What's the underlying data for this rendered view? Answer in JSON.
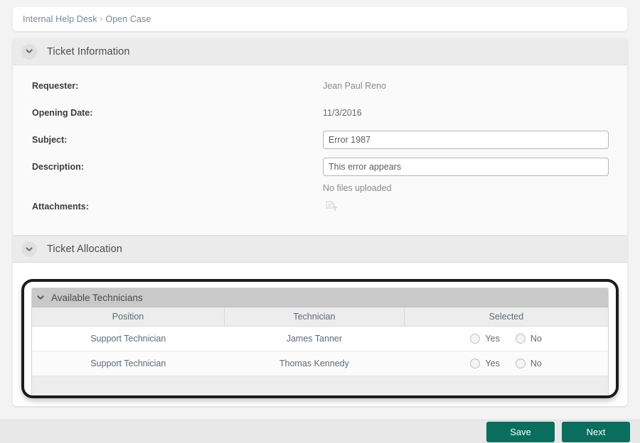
{
  "breadcrumb": {
    "root": "Internal Help Desk",
    "separator": "›",
    "current": "Open Case"
  },
  "sections": {
    "ticket_information": {
      "title": "Ticket Information",
      "collapse_icon": "chevron-down-icon",
      "fields": {
        "requester": {
          "label": "Requester:",
          "value": "Jean Paul Reno"
        },
        "opening_date": {
          "label": "Opening Date:",
          "value": "11/3/2016"
        },
        "subject": {
          "label": "Subject:",
          "value": "Error 1987",
          "placeholder": ""
        },
        "description": {
          "label": "Description:",
          "value": "This error appears",
          "placeholder": ""
        },
        "attachments": {
          "label": "Attachments:",
          "value": "No files uploaded",
          "upload_icon": "file-upload-icon"
        }
      }
    },
    "ticket_allocation": {
      "title": "Ticket Allocation",
      "collapse_icon": "chevron-down-icon"
    }
  },
  "available_technicians": {
    "title": "Available Technicians",
    "collapse_icon": "chevron-down-icon",
    "columns": [
      "Position",
      "Technician",
      "Selected"
    ],
    "rows": [
      {
        "position": "Support Technician",
        "technician": "James Tanner",
        "yes_label": "Yes",
        "no_label": "No",
        "selected": null
      },
      {
        "position": "Support Technician",
        "technician": "Thomas Kennedy",
        "yes_label": "Yes",
        "no_label": "No",
        "selected": null
      }
    ]
  },
  "footer": {
    "save_label": "Save",
    "next_label": "Next"
  },
  "colors": {
    "button_teal": "#0a6e5f",
    "highlight_outline": "#1c1c1c",
    "page_background": "#f3f3f3",
    "section_header": "#ebebeb",
    "panel_header": "#c9c9c9"
  }
}
